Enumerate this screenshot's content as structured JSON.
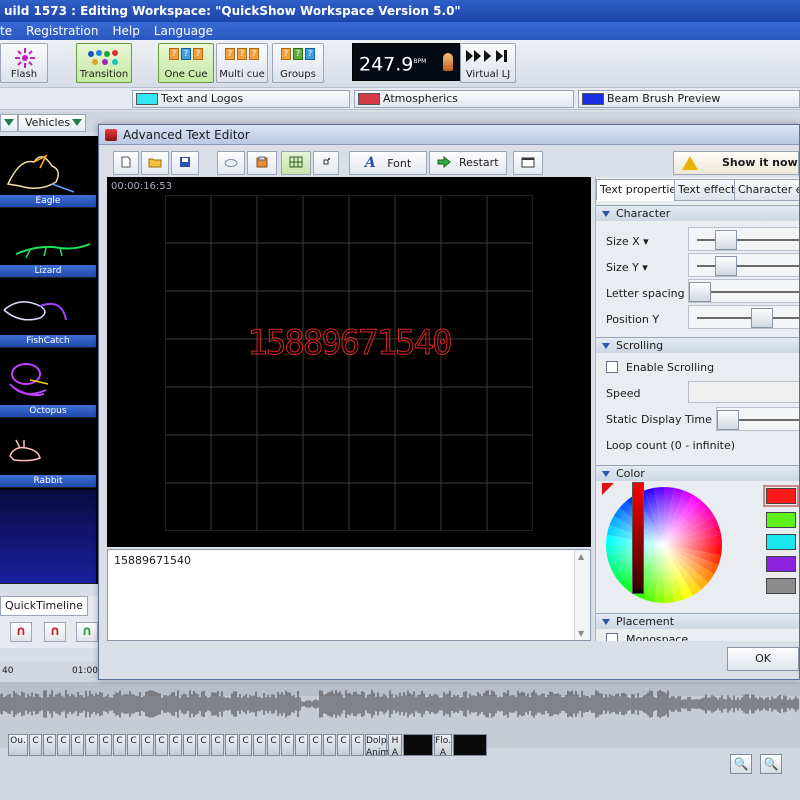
{
  "window": {
    "title": "uild 1573 : Editing Workspace: \"QuickShow Workspace Version 5.0\""
  },
  "menu": [
    "te",
    "Registration",
    "Help",
    "Language"
  ],
  "toolbar": {
    "flash_label": "Flash",
    "transition_label": "Transition",
    "one_cue_label": "One Cue",
    "multi_cue_label": "Multi cue",
    "groups_label": "Groups",
    "bpm_value": "247.9",
    "bpm_unit": "BPM",
    "virtual_lj_label": "Virtual LJ"
  },
  "categories": [
    {
      "label": "Text and Logos",
      "color": "#33e6f2"
    },
    {
      "label": "Atmospherics",
      "color": "#d23a48"
    },
    {
      "label": "Beam Brush Preview",
      "color": "#1a2de0"
    }
  ],
  "tabs": {
    "vehicles_label": "Vehicles"
  },
  "thumbnails": [
    "Eagle",
    "Lizard",
    "FishCatch",
    "Octopus",
    "Rabbit"
  ],
  "quick_timeline_label": "QuickTimeline",
  "timeline": {
    "ruler_labels": [
      "40",
      "01:00"
    ],
    "cue_labels": [
      "Ou.",
      "C",
      "Dolp. Anim.",
      "H A",
      "Flo. A"
    ]
  },
  "dialog": {
    "title": "Advanced Text Editor",
    "font_button_label": "Font",
    "restart_button_label": "Restart",
    "show_it_now_label": "Show it now",
    "timecode": "00:00:16:53",
    "laser_text": "15889671540",
    "text_input_value": "15889671540",
    "ok_label": "OK",
    "props": {
      "tabs": [
        "Text properties",
        "Text effect",
        "Character effe"
      ],
      "character_header": "Character",
      "size_x_label": "Size X",
      "size_y_label": "Size Y",
      "letter_spacing_label": "Letter spacing",
      "position_y_label": "Position Y",
      "scrolling_header": "Scrolling",
      "enable_scrolling_label": "Enable Scrolling",
      "speed_label": "Speed",
      "static_display_label": "Static Display Time",
      "loop_count_label": "Loop count (0 - infinite)",
      "color_header": "Color",
      "placement_header": "Placement",
      "monospace_label": "Monospace",
      "swatches": [
        "#ff1a1a",
        "#5ff21a",
        "#1ae6f0",
        "#8a22e0",
        "#8c8c8c"
      ]
    }
  }
}
